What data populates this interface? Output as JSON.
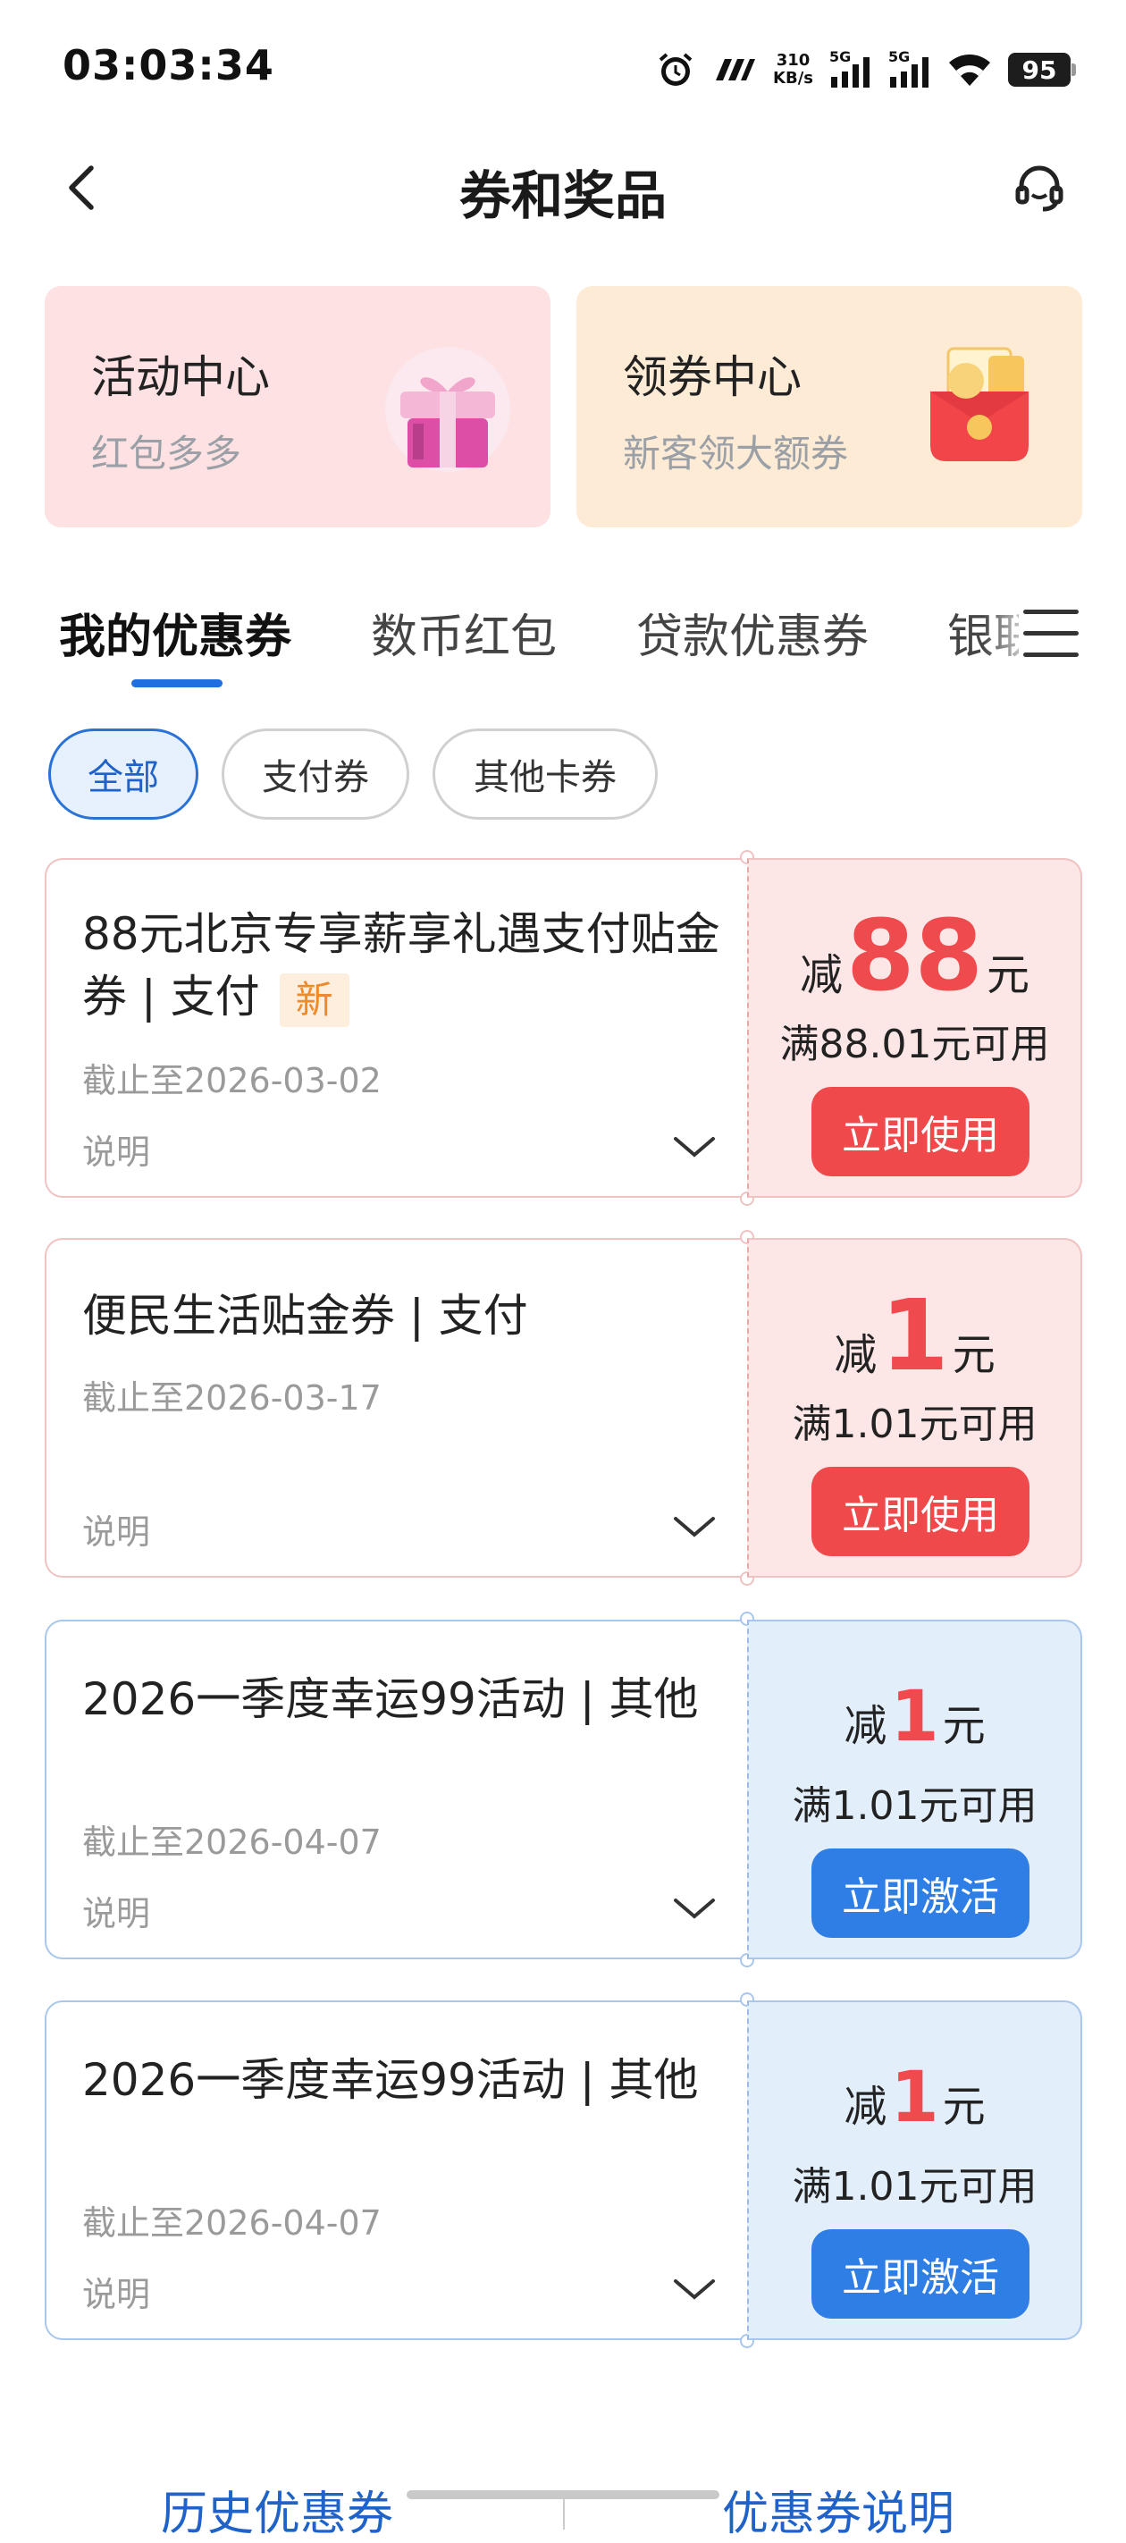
{
  "status_bar": {
    "time": "03:03:34",
    "net_speed_value": "310",
    "net_speed_unit": "KB/s",
    "sim1": "5G",
    "sim2": "5G",
    "battery": "95"
  },
  "header": {
    "title": "券和奖品"
  },
  "promos": [
    {
      "title": "活动中心",
      "subtitle": "红包多多"
    },
    {
      "title": "领券中心",
      "subtitle": "新客领大额券"
    }
  ],
  "tabs": [
    "我的优惠券",
    "数币红包",
    "贷款优惠券",
    "银联"
  ],
  "filters": [
    "全部",
    "支付券",
    "其他卡券"
  ],
  "coupons": [
    {
      "title": "88元北京专享薪享礼遇支付贴金券 | 支付",
      "badge": "新",
      "expiry": "截止至2026-03-02",
      "desc_label": "说明",
      "amount_prefix": "减",
      "amount": "88",
      "amount_unit": "元",
      "threshold": "满88.01元可用",
      "action": "立即使用"
    },
    {
      "title": "便民生活贴金券 | 支付",
      "expiry": "截止至2026-03-17",
      "desc_label": "说明",
      "amount_prefix": "减",
      "amount": "1",
      "amount_unit": "元",
      "threshold": "满1.01元可用",
      "action": "立即使用"
    },
    {
      "title": "2026一季度幸运99活动 | 其他",
      "expiry": "截止至2026-04-07",
      "desc_label": "说明",
      "amount_prefix": "减",
      "amount": "1",
      "amount_unit": "元",
      "threshold": "满1.01元可用",
      "action": "立即激活"
    },
    {
      "title": "2026一季度幸运99活动 | 其他",
      "expiry": "截止至2026-04-07",
      "desc_label": "说明",
      "amount_prefix": "减",
      "amount": "1",
      "amount_unit": "元",
      "threshold": "满1.01元可用",
      "action": "立即激活"
    }
  ],
  "footer": {
    "history_link": "历史优惠券",
    "help_link": "优惠券说明"
  },
  "colors": {
    "accent_blue": "#1f6fe0",
    "amount_red": "#ef4a4d",
    "use_button_red": "#f0494b",
    "activate_button_blue": "#2f7ee6"
  }
}
